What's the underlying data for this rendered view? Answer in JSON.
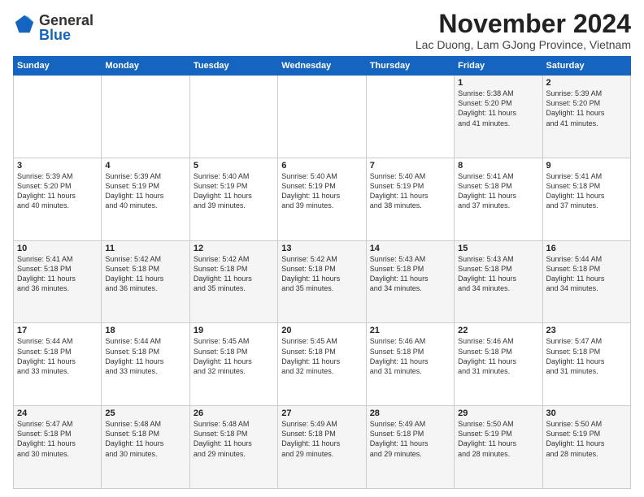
{
  "logo": {
    "general": "General",
    "blue": "Blue"
  },
  "title": "November 2024",
  "subtitle": "Lac Duong, Lam GJong Province, Vietnam",
  "headers": [
    "Sunday",
    "Monday",
    "Tuesday",
    "Wednesday",
    "Thursday",
    "Friday",
    "Saturday"
  ],
  "weeks": [
    [
      {
        "day": "",
        "info": ""
      },
      {
        "day": "",
        "info": ""
      },
      {
        "day": "",
        "info": ""
      },
      {
        "day": "",
        "info": ""
      },
      {
        "day": "",
        "info": ""
      },
      {
        "day": "1",
        "info": "Sunrise: 5:38 AM\nSunset: 5:20 PM\nDaylight: 11 hours\nand 41 minutes."
      },
      {
        "day": "2",
        "info": "Sunrise: 5:39 AM\nSunset: 5:20 PM\nDaylight: 11 hours\nand 41 minutes."
      }
    ],
    [
      {
        "day": "3",
        "info": "Sunrise: 5:39 AM\nSunset: 5:20 PM\nDaylight: 11 hours\nand 40 minutes."
      },
      {
        "day": "4",
        "info": "Sunrise: 5:39 AM\nSunset: 5:19 PM\nDaylight: 11 hours\nand 40 minutes."
      },
      {
        "day": "5",
        "info": "Sunrise: 5:40 AM\nSunset: 5:19 PM\nDaylight: 11 hours\nand 39 minutes."
      },
      {
        "day": "6",
        "info": "Sunrise: 5:40 AM\nSunset: 5:19 PM\nDaylight: 11 hours\nand 39 minutes."
      },
      {
        "day": "7",
        "info": "Sunrise: 5:40 AM\nSunset: 5:19 PM\nDaylight: 11 hours\nand 38 minutes."
      },
      {
        "day": "8",
        "info": "Sunrise: 5:41 AM\nSunset: 5:18 PM\nDaylight: 11 hours\nand 37 minutes."
      },
      {
        "day": "9",
        "info": "Sunrise: 5:41 AM\nSunset: 5:18 PM\nDaylight: 11 hours\nand 37 minutes."
      }
    ],
    [
      {
        "day": "10",
        "info": "Sunrise: 5:41 AM\nSunset: 5:18 PM\nDaylight: 11 hours\nand 36 minutes."
      },
      {
        "day": "11",
        "info": "Sunrise: 5:42 AM\nSunset: 5:18 PM\nDaylight: 11 hours\nand 36 minutes."
      },
      {
        "day": "12",
        "info": "Sunrise: 5:42 AM\nSunset: 5:18 PM\nDaylight: 11 hours\nand 35 minutes."
      },
      {
        "day": "13",
        "info": "Sunrise: 5:42 AM\nSunset: 5:18 PM\nDaylight: 11 hours\nand 35 minutes."
      },
      {
        "day": "14",
        "info": "Sunrise: 5:43 AM\nSunset: 5:18 PM\nDaylight: 11 hours\nand 34 minutes."
      },
      {
        "day": "15",
        "info": "Sunrise: 5:43 AM\nSunset: 5:18 PM\nDaylight: 11 hours\nand 34 minutes."
      },
      {
        "day": "16",
        "info": "Sunrise: 5:44 AM\nSunset: 5:18 PM\nDaylight: 11 hours\nand 34 minutes."
      }
    ],
    [
      {
        "day": "17",
        "info": "Sunrise: 5:44 AM\nSunset: 5:18 PM\nDaylight: 11 hours\nand 33 minutes."
      },
      {
        "day": "18",
        "info": "Sunrise: 5:44 AM\nSunset: 5:18 PM\nDaylight: 11 hours\nand 33 minutes."
      },
      {
        "day": "19",
        "info": "Sunrise: 5:45 AM\nSunset: 5:18 PM\nDaylight: 11 hours\nand 32 minutes."
      },
      {
        "day": "20",
        "info": "Sunrise: 5:45 AM\nSunset: 5:18 PM\nDaylight: 11 hours\nand 32 minutes."
      },
      {
        "day": "21",
        "info": "Sunrise: 5:46 AM\nSunset: 5:18 PM\nDaylight: 11 hours\nand 31 minutes."
      },
      {
        "day": "22",
        "info": "Sunrise: 5:46 AM\nSunset: 5:18 PM\nDaylight: 11 hours\nand 31 minutes."
      },
      {
        "day": "23",
        "info": "Sunrise: 5:47 AM\nSunset: 5:18 PM\nDaylight: 11 hours\nand 31 minutes."
      }
    ],
    [
      {
        "day": "24",
        "info": "Sunrise: 5:47 AM\nSunset: 5:18 PM\nDaylight: 11 hours\nand 30 minutes."
      },
      {
        "day": "25",
        "info": "Sunrise: 5:48 AM\nSunset: 5:18 PM\nDaylight: 11 hours\nand 30 minutes."
      },
      {
        "day": "26",
        "info": "Sunrise: 5:48 AM\nSunset: 5:18 PM\nDaylight: 11 hours\nand 29 minutes."
      },
      {
        "day": "27",
        "info": "Sunrise: 5:49 AM\nSunset: 5:18 PM\nDaylight: 11 hours\nand 29 minutes."
      },
      {
        "day": "28",
        "info": "Sunrise: 5:49 AM\nSunset: 5:18 PM\nDaylight: 11 hours\nand 29 minutes."
      },
      {
        "day": "29",
        "info": "Sunrise: 5:50 AM\nSunset: 5:19 PM\nDaylight: 11 hours\nand 28 minutes."
      },
      {
        "day": "30",
        "info": "Sunrise: 5:50 AM\nSunset: 5:19 PM\nDaylight: 11 hours\nand 28 minutes."
      }
    ]
  ]
}
